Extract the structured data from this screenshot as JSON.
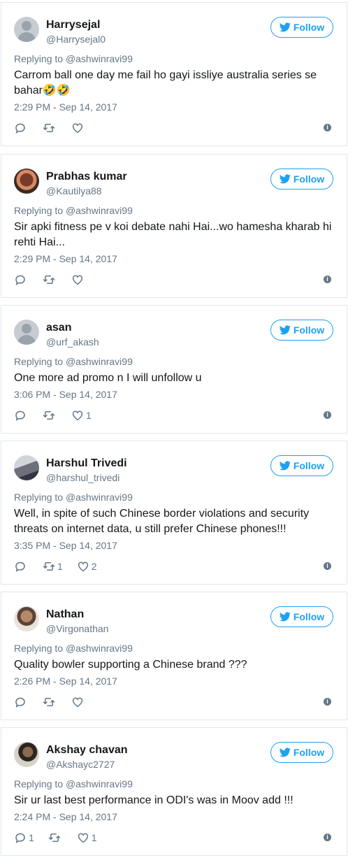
{
  "replying_prefix": "Replying to",
  "reply_to_handle": "@ashwinravi99",
  "follow_label": "Follow",
  "colors": {
    "accent": "#1da1f2",
    "muted": "#657786",
    "border": "#e1e8ed"
  },
  "tweets": [
    {
      "name": "Harrysejal",
      "handle": "@Harrysejal0",
      "text": "Carrom ball one day me fail ho gayi issliye australia series se bahar🤣🤣",
      "time": "2:29 PM - Sep 14, 2017",
      "replies": "",
      "retweets": "",
      "likes": ""
    },
    {
      "name": "Prabhas kumar",
      "handle": "@Kautilya88",
      "text": "Sir apki fitness pe v koi debate nahi Hai...wo hamesha kharab hi rehti Hai...",
      "time": "2:29 PM - Sep 14, 2017",
      "replies": "",
      "retweets": "",
      "likes": ""
    },
    {
      "name": "asan",
      "handle": "@urf_akash",
      "text": "One more ad promo n I will unfollow u",
      "time": "3:06 PM - Sep 14, 2017",
      "replies": "",
      "retweets": "",
      "likes": "1"
    },
    {
      "name": "Harshul Trivedi",
      "handle": "@harshul_trivedi",
      "text": "Well, in spite of such Chinese border violations and security threats on internet data, u still prefer Chinese phones!!!",
      "time": "3:35 PM - Sep 14, 2017",
      "replies": "",
      "retweets": "1",
      "likes": "2"
    },
    {
      "name": "Nathan",
      "handle": "@Virgonathan",
      "text": "Quality bowler supporting a Chinese brand ???",
      "time": "2:26 PM - Sep 14, 2017",
      "replies": "",
      "retweets": "",
      "likes": ""
    },
    {
      "name": "Akshay chavan",
      "handle": "@Akshayc2727",
      "text": "Sir ur last best performance in ODI's was in Moov add !!!",
      "time": "2:24 PM - Sep 14, 2017",
      "replies": "1",
      "retweets": "",
      "likes": "1"
    }
  ]
}
